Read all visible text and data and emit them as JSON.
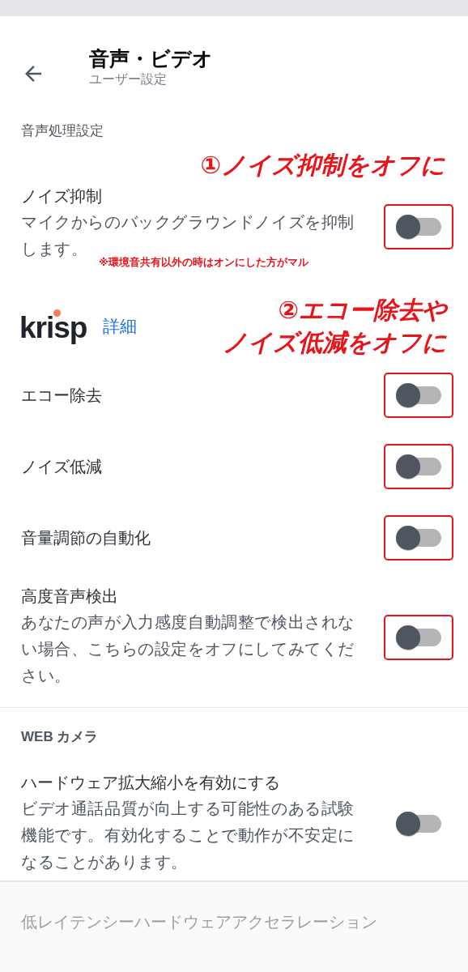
{
  "header": {
    "title": "音声・ビデオ",
    "subtitle": "ユーザー設定"
  },
  "voice_section": {
    "heading": "音声処理設定",
    "annotation": "①ノイズ抑制をオフに",
    "items": [
      {
        "title": "ノイズ抑制",
        "description": "マイクからのバックグラウンドノイズを抑制します。",
        "note": "※環境音共有以外の時はオンにした方がマル",
        "on": false,
        "highlighted": true
      }
    ]
  },
  "krisp": {
    "logo": "krisp",
    "link": "詳細",
    "annotation_lines": [
      "②エコー除去や",
      "ノイズ低減をオフに"
    ]
  },
  "krisp_items": [
    {
      "title": "エコー除去",
      "on": false,
      "highlighted": true
    },
    {
      "title": "ノイズ低減",
      "on": false,
      "highlighted": true
    },
    {
      "title": "音量調節の自動化",
      "on": false,
      "highlighted": true
    },
    {
      "title": "高度音声検出",
      "description": "あなたの声が入力感度自動調整で検出されない場合、こちらの設定をオフにしてみてください。",
      "on": false,
      "highlighted": true
    }
  ],
  "webcam_section": {
    "heading": "WEB カメラ",
    "items": [
      {
        "title": "ハードウェア拡大縮小を有効にする",
        "description": "ビデオ通話品質が向上する可能性のある試験機能です。有効化することで動作が不安定になることがあります。",
        "on": false,
        "highlighted": false
      }
    ]
  },
  "next_item": {
    "title": "低レイテンシーハードウェアアクセラレーション"
  }
}
